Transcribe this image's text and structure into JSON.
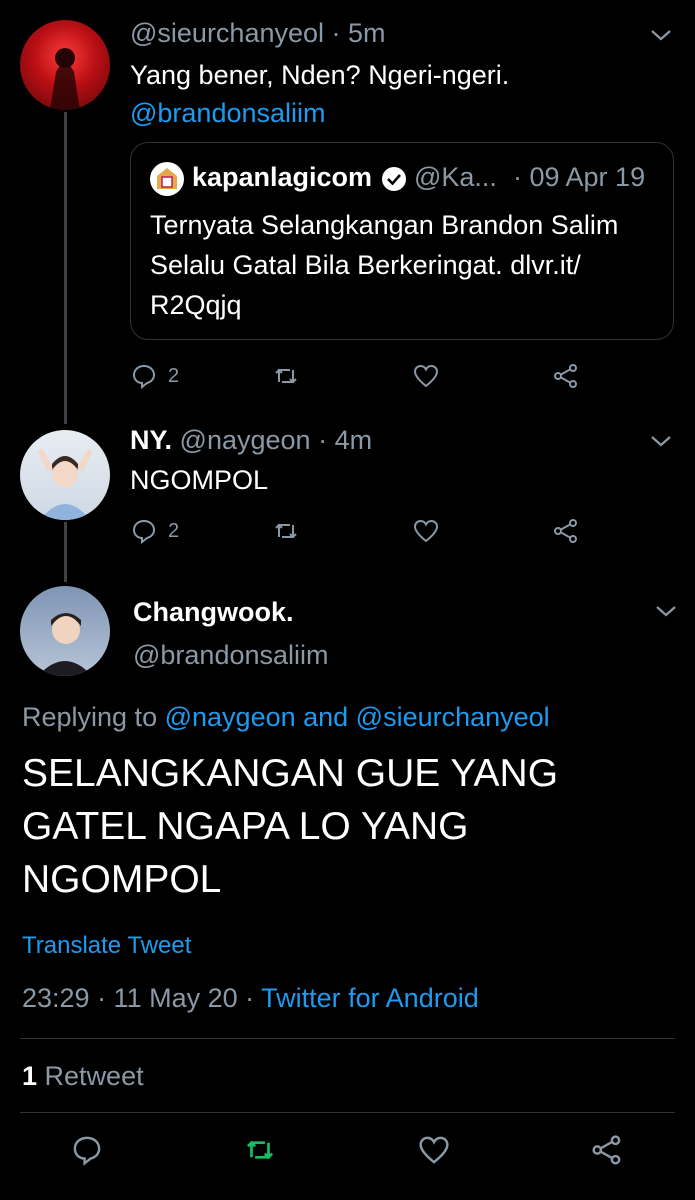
{
  "tweet1": {
    "handle": "@sieurchanyeol",
    "time": "· 5m",
    "text": "Yang bener, Nden? Ngeri-ngeri.",
    "mention": "@brandonsaliim",
    "quote": {
      "name": "kapanlagicom",
      "handle": "@Ka...",
      "date": "· 09 Apr 19",
      "text_line1": "Ternyata Selangkangan Brandon Salim",
      "text_line2": "Selalu Gatal Bila Berkeringat. dlvr.it/",
      "text_line3": "R2Qqjq"
    },
    "reply_count": "2"
  },
  "tweet2": {
    "name": "NY.",
    "handle": "@naygeon",
    "time": "· 4m",
    "text": "NGOMPOL",
    "reply_count": "2"
  },
  "main": {
    "name": "Changwook.",
    "handle": "@brandonsaliim",
    "replying_prefix": "Replying to",
    "replying_users": "@naygeon and @sieurchanyeol",
    "text_line1": "SELANGKANGAN GUE YANG",
    "text_line2": "GATEL NGAPA LO YANG",
    "text_line3": "NGOMPOL",
    "translate": "Translate Tweet",
    "timestamp": "23:29 · 11 May 20 ·",
    "source": "Twitter for Android",
    "retweet_count": "1",
    "retweet_label": "Retweet"
  },
  "colors": {
    "accent": "#1d9bf0",
    "retweet_green": "#17bf63",
    "muted": "#8b98a5"
  }
}
